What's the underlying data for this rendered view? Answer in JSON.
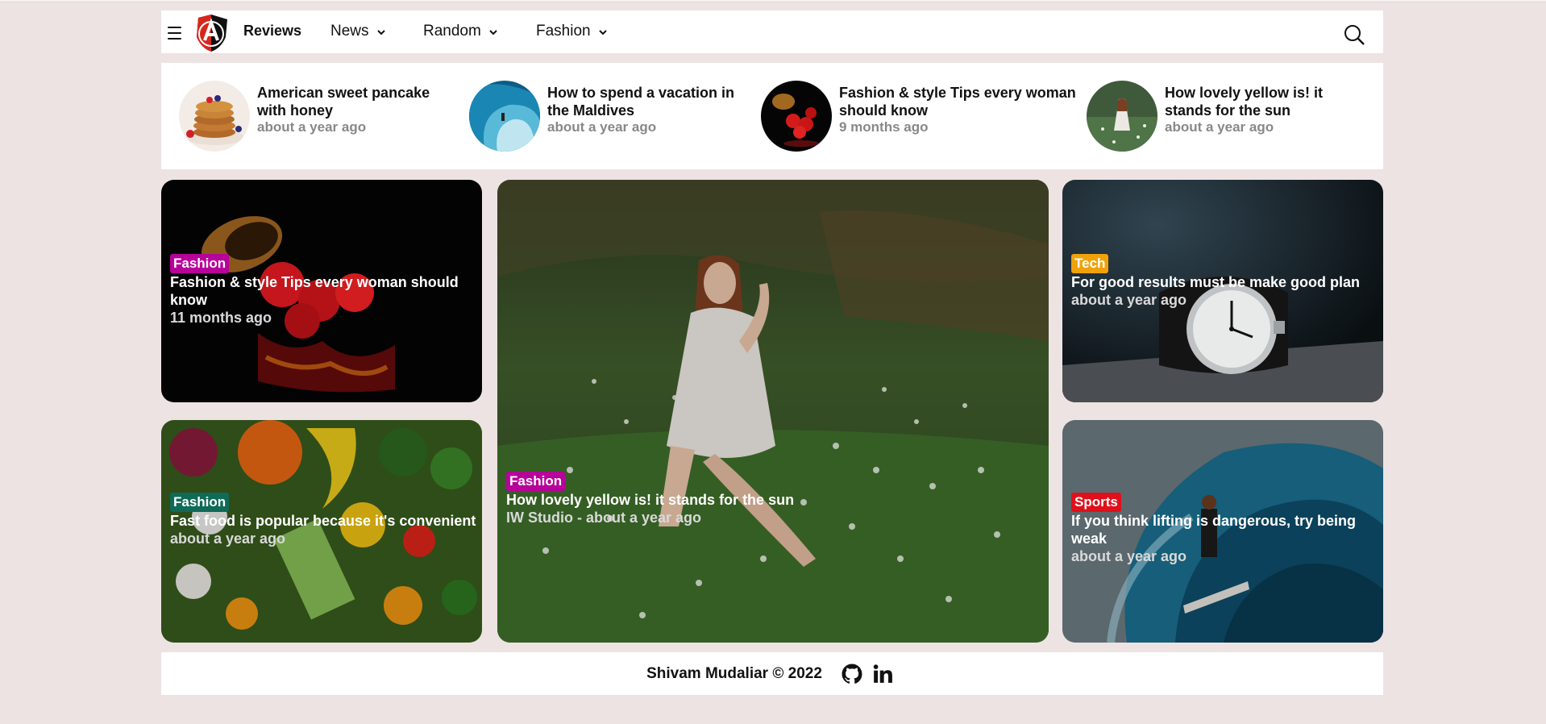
{
  "nav": {
    "brand": "Reviews",
    "items": [
      {
        "label": "News"
      },
      {
        "label": "Random"
      },
      {
        "label": "Fashion"
      }
    ]
  },
  "trending": [
    {
      "title": "American sweet pancake with honey",
      "date": "about a year ago",
      "image": "pancake"
    },
    {
      "title": "How to spend a vacation in the Maldives",
      "date": "about a year ago",
      "image": "wave"
    },
    {
      "title": "Fashion & style Tips every woman should know",
      "date": "9 months ago",
      "image": "strawberries"
    },
    {
      "title": "How lovely yellow is! it stands for the sun",
      "date": "about a year ago",
      "image": "woman-field"
    }
  ],
  "cards": {
    "top_left": {
      "category": "Fashion",
      "category_color": "#b8009a",
      "title": "Fashion & style Tips every woman should know",
      "date": "11 months ago"
    },
    "bottom_left": {
      "category": "Fashion",
      "category_color": "#0f6b57",
      "title": "Fast food is popular because it's convenient",
      "date": "about a year ago"
    },
    "center": {
      "category": "Fashion",
      "category_color": "#b8009a",
      "title": "How lovely yellow is! it stands for the sun",
      "date": "IW Studio - about a year ago"
    },
    "top_right": {
      "category": "Tech",
      "category_color": "#f0a20a",
      "title": "For good results must be make good plan",
      "date": "about a year ago"
    },
    "bottom_right": {
      "category": "Sports",
      "category_color": "#e0101a",
      "title": "If you think lifting is dangerous, try being weak",
      "date": "about a year ago"
    }
  },
  "footer": {
    "text": "Shivam Mudaliar © 2022",
    "icons": [
      "github-icon",
      "linkedin-icon"
    ]
  }
}
